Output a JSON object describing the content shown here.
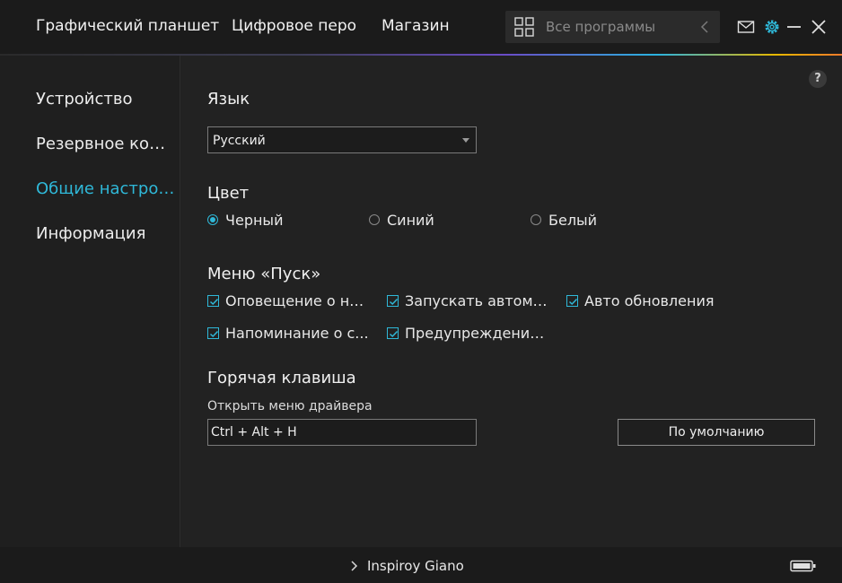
{
  "topnav": {
    "tabs": [
      {
        "label": "Графический планшет"
      },
      {
        "label": "Цифровое перо"
      },
      {
        "label": "Магазин"
      }
    ],
    "search": {
      "placeholder": "Все программы",
      "icon": "grid-icon"
    },
    "icons": [
      "mail-icon",
      "gear-icon",
      "minimize-icon",
      "close-icon"
    ]
  },
  "sidebar": {
    "items": [
      {
        "label": "Устройство",
        "active": false
      },
      {
        "label": "Резервное копи...",
        "active": false
      },
      {
        "label": "Общие настрой...",
        "active": true
      },
      {
        "label": "Информация",
        "active": false
      }
    ]
  },
  "settings": {
    "language": {
      "title": "Язык",
      "selected": "Русский"
    },
    "color": {
      "title": "Цвет",
      "options": [
        {
          "label": "Черный",
          "checked": true
        },
        {
          "label": "Синий",
          "checked": false
        },
        {
          "label": "Белый",
          "checked": false
        }
      ]
    },
    "start_menu": {
      "title": "Меню «Пуск»",
      "options": [
        {
          "label": "Оповещение о но...",
          "checked": true
        },
        {
          "label": "Запускать автомат...",
          "checked": true
        },
        {
          "label": "Авто обновления",
          "checked": true
        },
        {
          "label": "Напоминание о с...",
          "checked": true
        },
        {
          "label": "Предупреждение ...",
          "checked": true
        }
      ]
    },
    "hotkey": {
      "title": "Горячая клавиша",
      "field_label": "Открыть меню драйвера",
      "value": "Ctrl + Alt + H",
      "default_button": "По умолчанию"
    },
    "help_label": "?"
  },
  "bottombar": {
    "device_name": "Inspiroy Giano"
  },
  "colors": {
    "accent": "#2fb8d8",
    "background": "#222222",
    "bar": "#1b1b1b"
  }
}
